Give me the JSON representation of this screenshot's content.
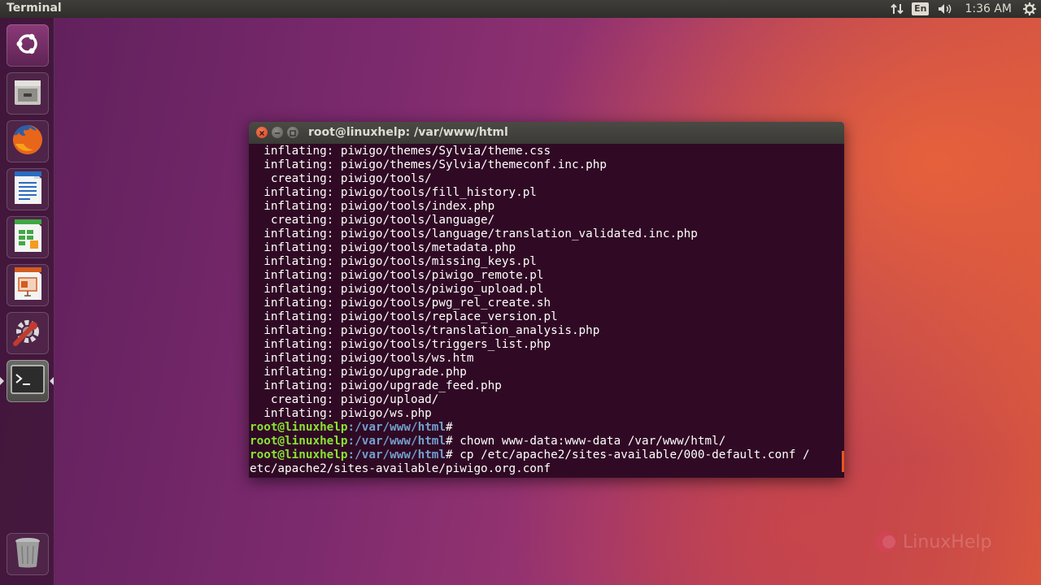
{
  "panel": {
    "app_title": "Terminal",
    "keyboard_layout": "En",
    "clock": "1:36 AM",
    "icons": [
      "network-arrows-icon",
      "keyboard-layout-icon",
      "volume-icon",
      "settings-gear-icon"
    ]
  },
  "launcher": {
    "items": [
      {
        "name": "ubuntu-dash",
        "icon": "ubuntu-logo-icon"
      },
      {
        "name": "files",
        "icon": "file-cabinet-icon"
      },
      {
        "name": "firefox",
        "icon": "firefox-icon"
      },
      {
        "name": "libreoffice-writer",
        "icon": "writer-document-icon"
      },
      {
        "name": "libreoffice-calc",
        "icon": "calc-spreadsheet-icon"
      },
      {
        "name": "libreoffice-impress",
        "icon": "impress-presentation-icon"
      },
      {
        "name": "system-settings",
        "icon": "settings-wrench-icon"
      },
      {
        "name": "terminal",
        "icon": "terminal-icon",
        "running": true
      },
      {
        "name": "trash",
        "icon": "trash-icon"
      }
    ]
  },
  "terminal": {
    "window_title": "root@linuxhelp: /var/www/html",
    "output_lines": [
      "  inflating: piwigo/themes/Sylvia/theme.css",
      "  inflating: piwigo/themes/Sylvia/themeconf.inc.php",
      "   creating: piwigo/tools/",
      "  inflating: piwigo/tools/fill_history.pl",
      "  inflating: piwigo/tools/index.php",
      "   creating: piwigo/tools/language/",
      "  inflating: piwigo/tools/language/translation_validated.inc.php",
      "  inflating: piwigo/tools/metadata.php",
      "  inflating: piwigo/tools/missing_keys.pl",
      "  inflating: piwigo/tools/piwigo_remote.pl",
      "  inflating: piwigo/tools/piwigo_upload.pl",
      "  inflating: piwigo/tools/pwg_rel_create.sh",
      "  inflating: piwigo/tools/replace_version.pl",
      "  inflating: piwigo/tools/translation_analysis.php",
      "  inflating: piwigo/tools/triggers_list.php",
      "  inflating: piwigo/tools/ws.htm",
      "  inflating: piwigo/upgrade.php",
      "  inflating: piwigo/upgrade_feed.php",
      "   creating: piwigo/upload/",
      "  inflating: piwigo/ws.php"
    ],
    "prompt_user": "root@linuxhelp",
    "prompt_path": ":/var/www/html",
    "prompt_symbol": "#",
    "commands": [
      "",
      " chown www-data:www-data /var/www/html/",
      " cp /etc/apache2/sites-available/000-default.conf /"
    ],
    "wrapped_line": "etc/apache2/sites-available/piwigo.org.conf"
  },
  "watermark": {
    "text": "LinuxHelp"
  },
  "colors": {
    "terminal_bg": "#300a24",
    "prompt_user": "#8ae234",
    "prompt_path": "#729fcf",
    "cursor": "#e95420"
  }
}
